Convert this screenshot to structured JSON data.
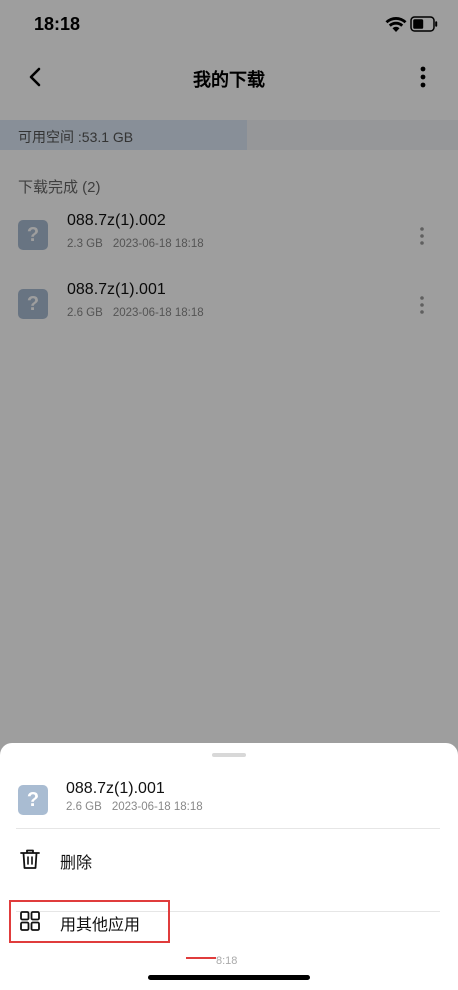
{
  "status_bar": {
    "time": "18:18"
  },
  "nav": {
    "title": "我的下载"
  },
  "storage": {
    "text": "可用空间 :53.1 GB",
    "used_fraction": 0.54
  },
  "section": {
    "title": "下载完成 (2)"
  },
  "files": [
    {
      "name": "088.7z(1).002",
      "size": "2.3 GB",
      "date": "2023-06-18 18:18",
      "icon_glyph": "?"
    },
    {
      "name": "088.7z(1).001",
      "size": "2.6 GB",
      "date": "2023-06-18 18:18",
      "icon_glyph": "?"
    }
  ],
  "sheet": {
    "file": {
      "name": "088.7z(1).001",
      "size": "2.6 GB",
      "date": "2023-06-18 18:18",
      "icon_glyph": "?"
    },
    "actions": [
      {
        "label": "删除",
        "icon": "trash-icon"
      },
      {
        "label": "用其他应用",
        "icon": "grid-icon"
      }
    ],
    "ghost_time": "8:18"
  },
  "colors": {
    "highlight": "#e03c3c",
    "file_icon": "#a9bcd2"
  }
}
